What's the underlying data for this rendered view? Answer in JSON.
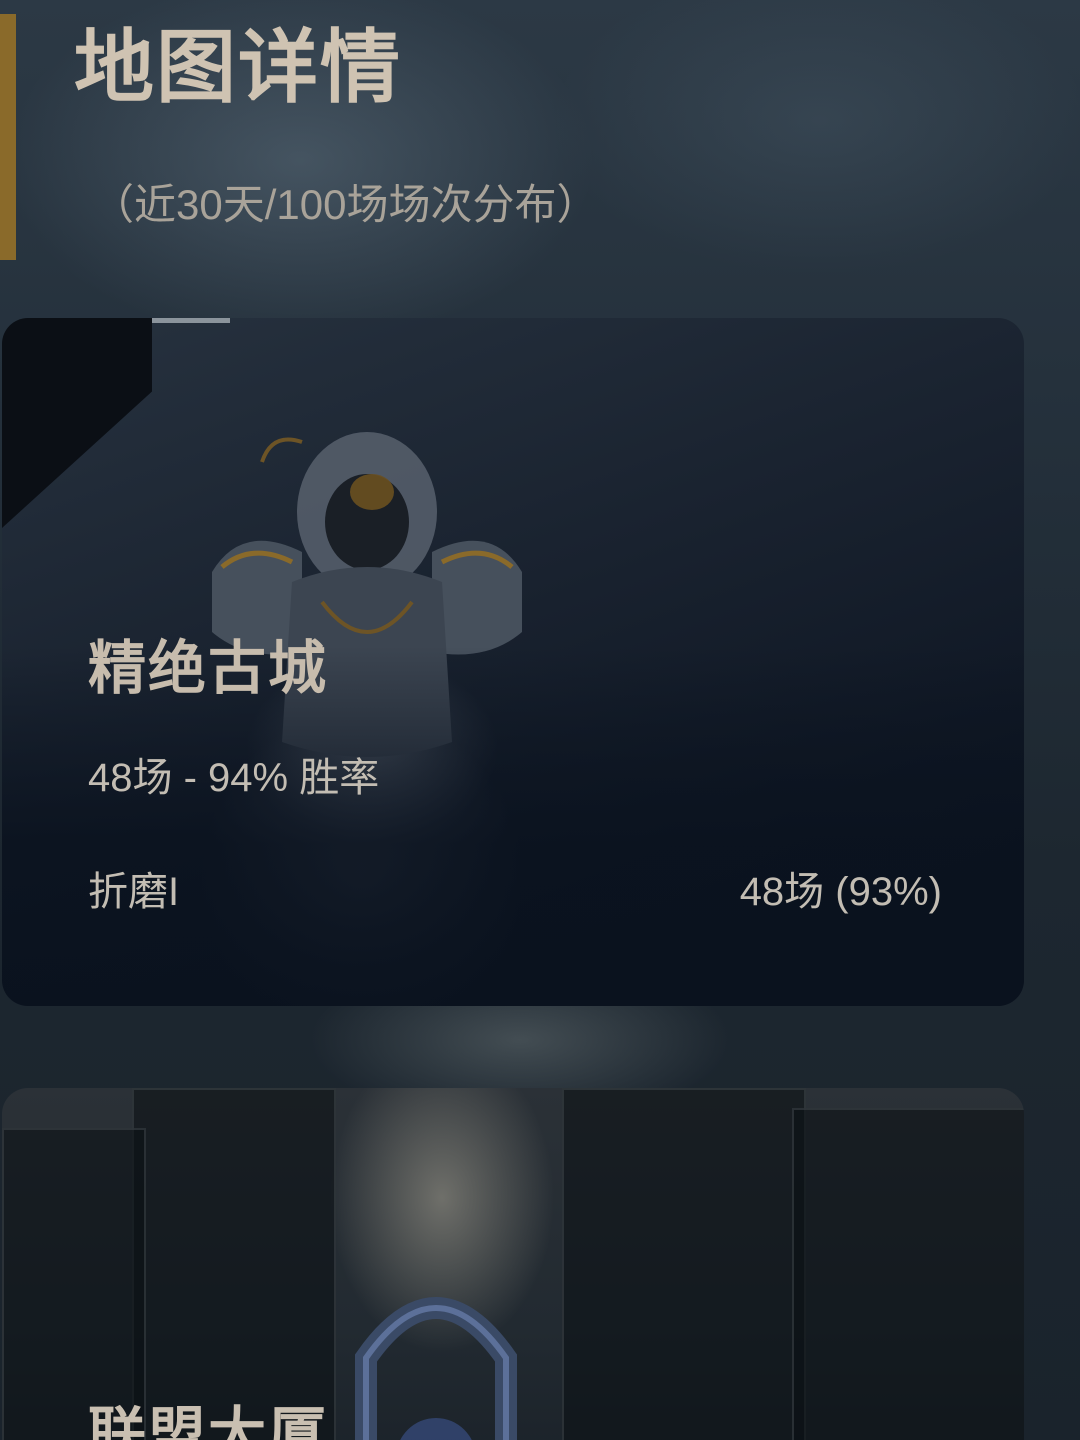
{
  "header": {
    "title": "地图详情",
    "subtitle": "（近30天/100场场次分布）"
  },
  "maps": [
    {
      "name": "精绝古城",
      "summary": "48场 - 94% 胜率",
      "difficulty_label": "折磨I",
      "difficulty_stats": "48场 (93%)"
    },
    {
      "name": "联盟大厦"
    }
  ],
  "colors": {
    "accent": "#8a6a2a",
    "title": "#cfc3b2",
    "text": "#c3bdb3",
    "card_bg": "#0f1724"
  }
}
